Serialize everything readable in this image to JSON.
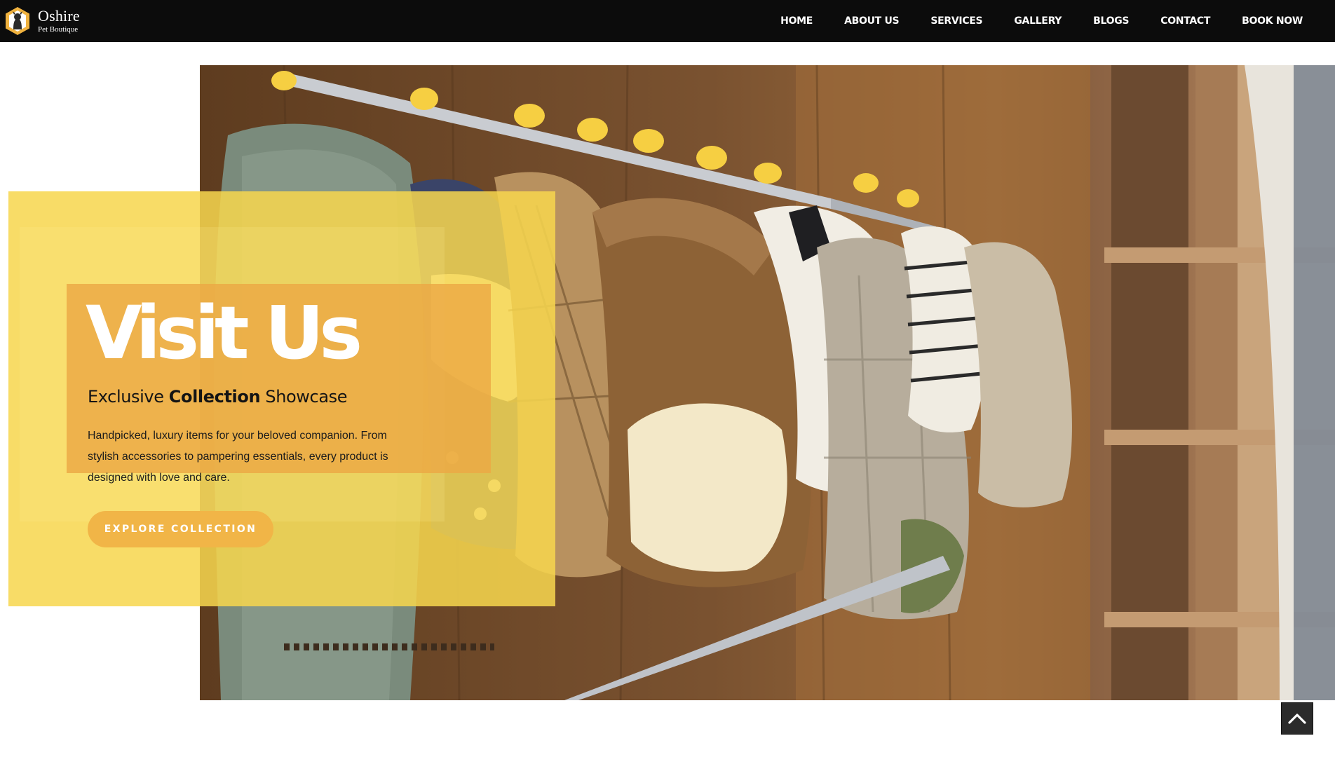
{
  "brand": {
    "name": "Oshire",
    "tagline": "Pet Boutique"
  },
  "nav": {
    "items": [
      {
        "label": "HOME"
      },
      {
        "label": "ABOUT US"
      },
      {
        "label": "SERVICES"
      },
      {
        "label": "GALLERY"
      },
      {
        "label": "BLOGS"
      },
      {
        "label": "CONTACT"
      },
      {
        "label": "BOOK NOW"
      }
    ]
  },
  "hero": {
    "title": "Visit Us",
    "subtitle_pre": "Exclusive ",
    "subtitle_bold": "Collection",
    "subtitle_post": " Showcase",
    "description": "Handpicked, luxury items for your beloved companion. From stylish accessories to pampering essentials, every product is designed with love and care.",
    "cta_label": "EXPLORE COLLECTION",
    "image_icon": "pet-clothing-rack-photo"
  },
  "scroll_top": {
    "icon": "chevron-up-icon"
  },
  "colors": {
    "header_bg": "#0c0c0c",
    "overlay_yellow": "#f7d64e",
    "overlay_orange": "#eca844",
    "cta_bg": "#f1b547",
    "scroll_top_bg": "#2b2b2b"
  }
}
